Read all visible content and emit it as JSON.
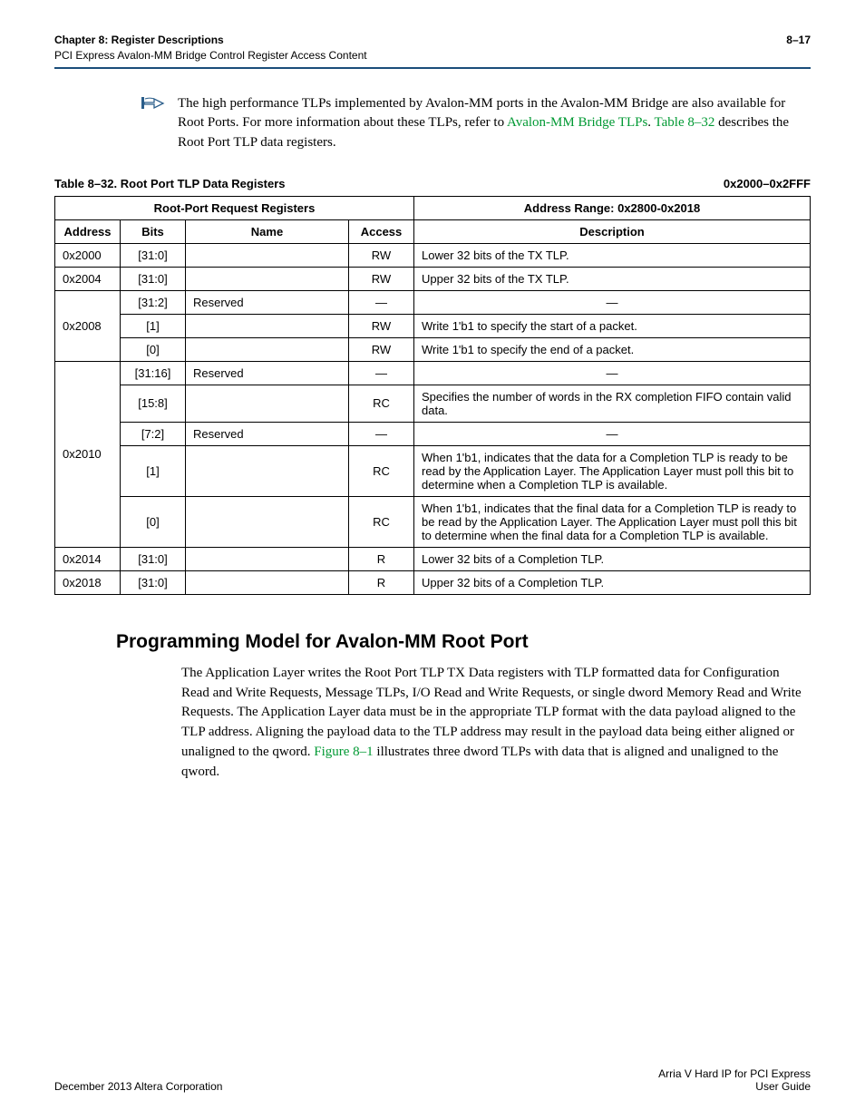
{
  "header": {
    "chapter_title": "Chapter 8:  Register Descriptions",
    "chapter_subtitle": "PCI Express Avalon-MM Bridge Control Register Access Content",
    "page_num": "8–17"
  },
  "note": {
    "text_before_link1": "The high performance TLPs implemented by Avalon-MM ports in the Avalon-MM Bridge are also available for Root Ports. For more information about these TLPs, refer to ",
    "link1": "Avalon-MM Bridge TLPs",
    "text_mid": ". ",
    "link2": "Table 8–32",
    "text_after": " describes the Root Port TLP data registers."
  },
  "table_caption": "Table 8–32.  Root Port TLP Data Registers",
  "table_caption_right": "0x2000–0x2FFF",
  "table": {
    "header1_left": "Root-Port Request Registers",
    "header1_right": "Address Range: 0x2800-0x2018",
    "cols": {
      "address": "Address",
      "bits": "Bits",
      "name": "Name",
      "access": "Access",
      "description": "Description"
    },
    "rows": [
      {
        "address": "0x2000",
        "bits": "[31:0]",
        "name": "",
        "access": "RW",
        "description": "Lower 32 bits of the TX TLP."
      },
      {
        "address": "0x2004",
        "bits": "[31:0]",
        "name": "",
        "access": "RW",
        "description": "Upper 32 bits of the TX TLP."
      },
      {
        "address": "0x2008",
        "sub": [
          {
            "bits": "[31:2]",
            "name": "Reserved",
            "access": "—",
            "description": "—",
            "desc_align": "center"
          },
          {
            "bits": "[1]",
            "name": "",
            "access": "RW",
            "description": "Write 1'b1 to specify the start of a packet."
          },
          {
            "bits": "[0]",
            "name": "",
            "access": "RW",
            "description": "Write 1'b1 to specify the end of a packet."
          }
        ]
      },
      {
        "address": "0x2010",
        "sub": [
          {
            "bits": "[31:16]",
            "name": "Reserved",
            "access": "—",
            "description": "—",
            "desc_align": "center"
          },
          {
            "bits": "[15:8]",
            "name": "",
            "access": "RC",
            "description": "Specifies the number of words in the RX completion FIFO contain valid data."
          },
          {
            "bits": "[7:2]",
            "name": "Reserved",
            "access": "—",
            "description": "—",
            "desc_align": "center"
          },
          {
            "bits": "[1]",
            "name": "",
            "access": "RC",
            "description": "When 1'b1, indicates that the data for a Completion TLP is ready to be read by the Application Layer. The Application Layer must poll this bit to determine when a Completion TLP is available."
          },
          {
            "bits": "[0]",
            "name": "",
            "access": "RC",
            "description": "When 1'b1, indicates that the final data for a Completion TLP is ready to be read by the Application Layer. The Application Layer must poll this bit to determine when the final data for a Completion TLP is available."
          }
        ]
      },
      {
        "address": "0x2014",
        "bits": "[31:0]",
        "name": "",
        "access": "R",
        "description": "Lower 32 bits of a Completion TLP."
      },
      {
        "address": "0x2018",
        "bits": "[31:0]",
        "name": "",
        "access": "R",
        "description": "Upper 32 bits of a Completion TLP."
      }
    ]
  },
  "section_heading": "Programming Model for Avalon-MM Root Port",
  "body_para": {
    "text_before": "The Application Layer writes the Root Port TLP TX Data registers with TLP formatted data for Configuration Read and Write Requests, Message TLPs, I/O Read and Write Requests, or single dword Memory Read and Write Requests. The Application Layer data must be in the appropriate TLP format with the data payload aligned to the TLP address. Aligning the payload data to the TLP address may result in the payload data being either aligned or unaligned to the qword. ",
    "figure_link": "Figure 8–1",
    "text_after": " illustrates three dword TLPs with data that is aligned and unaligned to the qword."
  },
  "footer": {
    "left": "December 2013   Altera Corporation",
    "right_line1": "Arria V Hard IP for PCI Express",
    "right_line2": "User Guide"
  }
}
